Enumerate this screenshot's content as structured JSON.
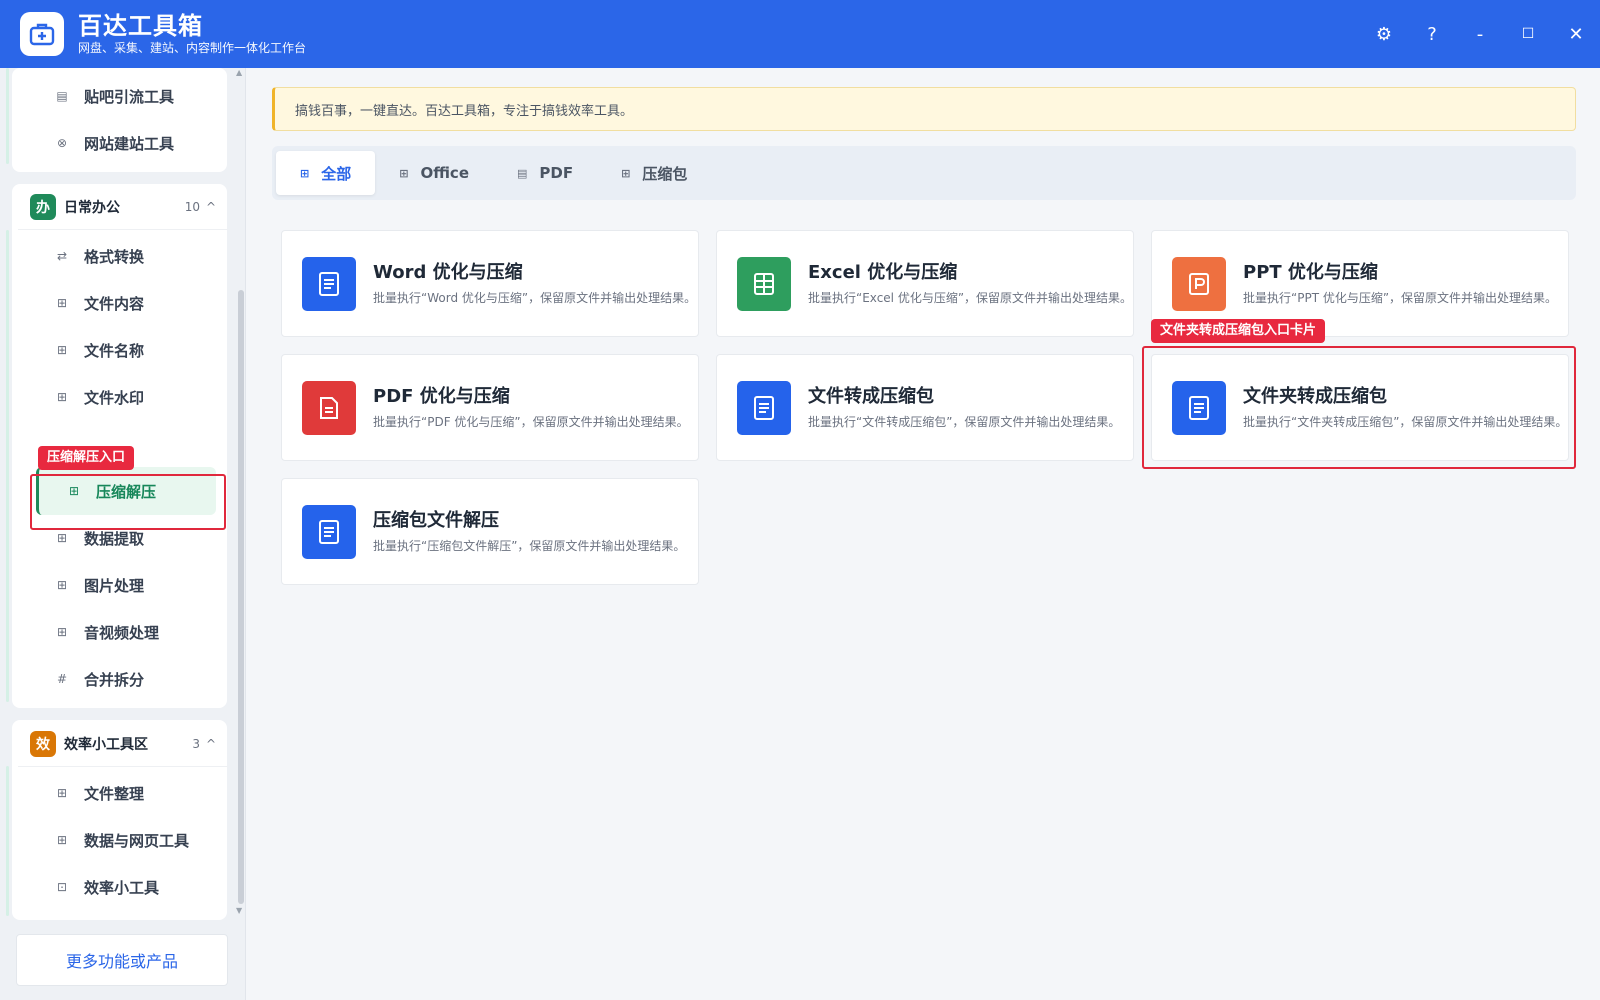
{
  "app": {
    "title": "百达工具箱",
    "subtitle": "网盘、采集、建站、内容制作一体化工作台"
  },
  "window_controls": {
    "settings": "⚙",
    "help": "?",
    "minimize": "-",
    "maximize": "☐",
    "close": "✕"
  },
  "sidebar": {
    "top_items": [
      {
        "label": "贴吧引流工具",
        "icon": "doc-icon"
      },
      {
        "label": "网站建站工具",
        "icon": "globe-icon"
      }
    ],
    "groups": [
      {
        "badge": "办",
        "badge_color": "#1f8a5a",
        "title": "日常办公",
        "count": "10",
        "caret": "^",
        "items": [
          {
            "label": "格式转换",
            "icon": "swap-icon"
          },
          {
            "label": "文件内容",
            "icon": "grid-icon"
          },
          {
            "label": "文件名称",
            "icon": "grid-icon"
          },
          {
            "label": "文件水印",
            "icon": "grid-icon"
          },
          {
            "label": "压缩解压",
            "icon": "grid-icon",
            "active": true
          },
          {
            "label": "数据提取",
            "icon": "grid-icon"
          },
          {
            "label": "图片处理",
            "icon": "grid-icon"
          },
          {
            "label": "音视频处理",
            "icon": "grid-icon"
          },
          {
            "label": "合并拆分",
            "icon": "hash-icon"
          }
        ]
      },
      {
        "badge": "效",
        "badge_color": "#d97706",
        "title": "效率小工具区",
        "count": "3",
        "caret": "^",
        "items": [
          {
            "label": "文件整理",
            "icon": "grid-icon"
          },
          {
            "label": "数据与网页工具",
            "icon": "grid-icon"
          },
          {
            "label": "效率小工具",
            "icon": "box-icon"
          }
        ]
      }
    ],
    "more_label": "更多功能或产品"
  },
  "callouts": {
    "sidebar": "压缩解压入口",
    "card": "文件夹转成压缩包入口卡片"
  },
  "notice": "搞钱百事，一键直达。百达工具箱，专注于搞钱效率工具。",
  "tabs": [
    {
      "label": "全部",
      "icon": "grid-icon",
      "active": true
    },
    {
      "label": "Office",
      "icon": "grid-icon"
    },
    {
      "label": "PDF",
      "icon": "doc-icon"
    },
    {
      "label": "压缩包",
      "icon": "grid-icon"
    }
  ],
  "cards": [
    {
      "title": "Word 优化与压缩",
      "desc": "批量执行“Word 优化与压缩”，保留原文件并输出处理结果。",
      "icon": "document-icon",
      "color": "#2563eb"
    },
    {
      "title": "Excel 优化与压缩",
      "desc": "批量执行“Excel 优化与压缩”，保留原文件并输出处理结果。",
      "icon": "table-icon",
      "color": "#2e9e5e"
    },
    {
      "title": "PPT 优化与压缩",
      "desc": "批量执行“PPT 优化与压缩”，保留原文件并输出处理结果。",
      "icon": "presentation-icon",
      "color": "#ee7040"
    },
    {
      "title": "PDF 优化与压缩",
      "desc": "批量执行“PDF 优化与压缩”，保留原文件并输出处理结果。",
      "icon": "pdf-icon",
      "color": "#e03a3a"
    },
    {
      "title": "文件转成压缩包",
      "desc": "批量执行“文件转成压缩包”，保留原文件并输出处理结果。",
      "icon": "document-icon",
      "color": "#2563eb"
    },
    {
      "title": "文件夹转成压缩包",
      "desc": "批量执行“文件夹转成压缩包”，保留原文件并输出处理结果。",
      "icon": "document-icon",
      "color": "#2563eb"
    },
    {
      "title": "压缩包文件解压",
      "desc": "批量执行“压缩包文件解压”，保留原文件并输出处理结果。",
      "icon": "document-icon",
      "color": "#2563eb"
    }
  ]
}
